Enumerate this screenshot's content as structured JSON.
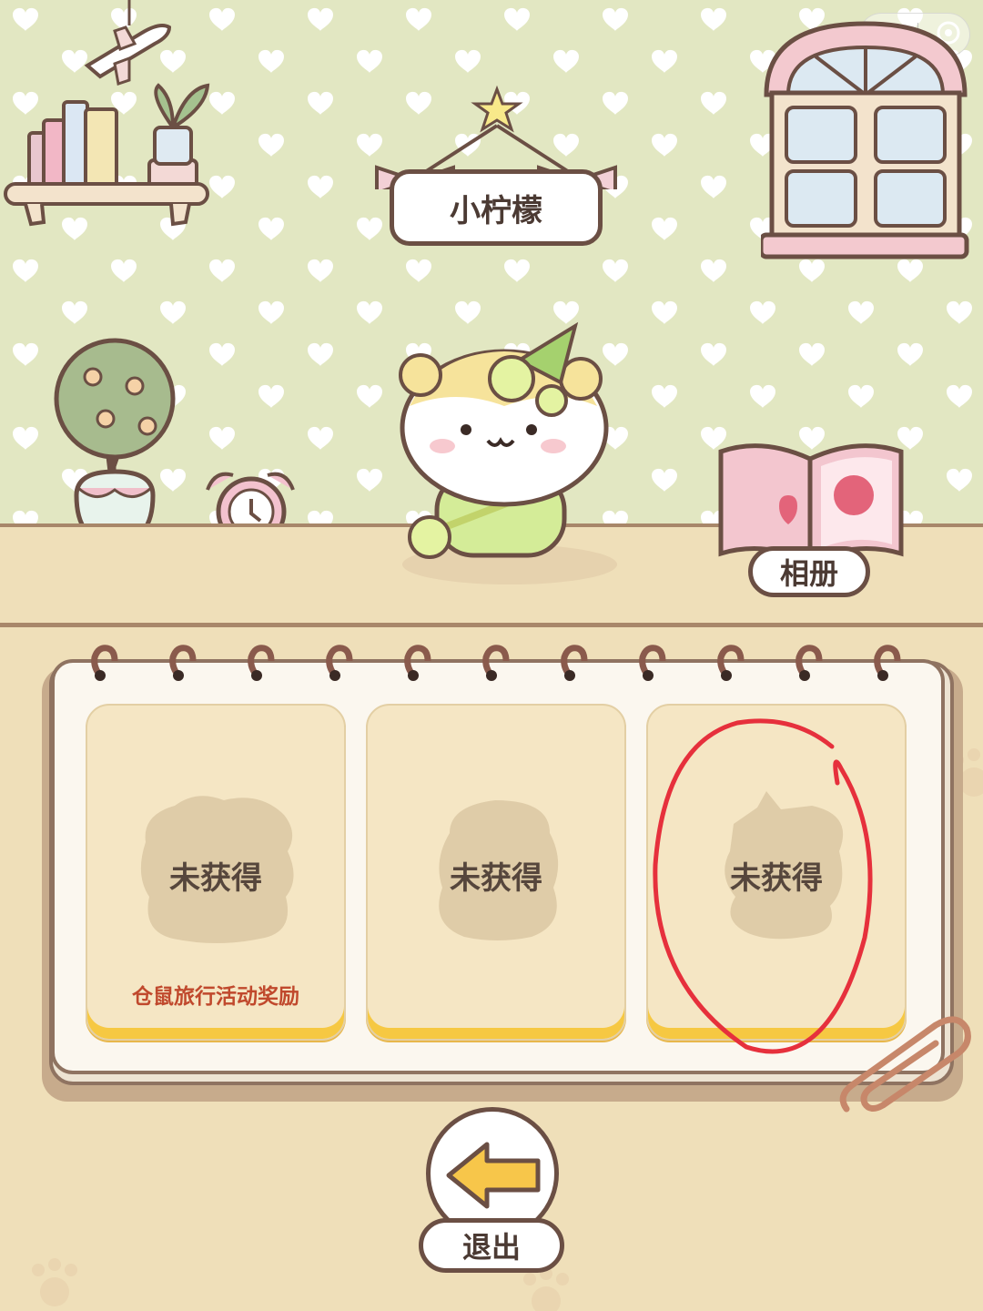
{
  "room": {
    "pet_name": "小柠檬",
    "album_label": "相册"
  },
  "collection": {
    "cards": [
      {
        "status": "未获得",
        "reward": "仓鼠旅行活动奖励"
      },
      {
        "status": "未获得",
        "reward": ""
      },
      {
        "status": "未获得",
        "reward": ""
      }
    ]
  },
  "footer": {
    "exit_label": "退出"
  },
  "icons": {
    "more": "more-icon",
    "close_miniprogram": "target-icon",
    "exit": "back-arrow-icon"
  },
  "colors": {
    "wallpaper": "#e2e7c2",
    "floor": "#efdfb9",
    "outline": "#6b4f44",
    "card_fill": "#f5e6c4",
    "card_stripe": "#f6c842",
    "reward_text": "#c0492d",
    "annotation_circle": "#e6303c"
  }
}
